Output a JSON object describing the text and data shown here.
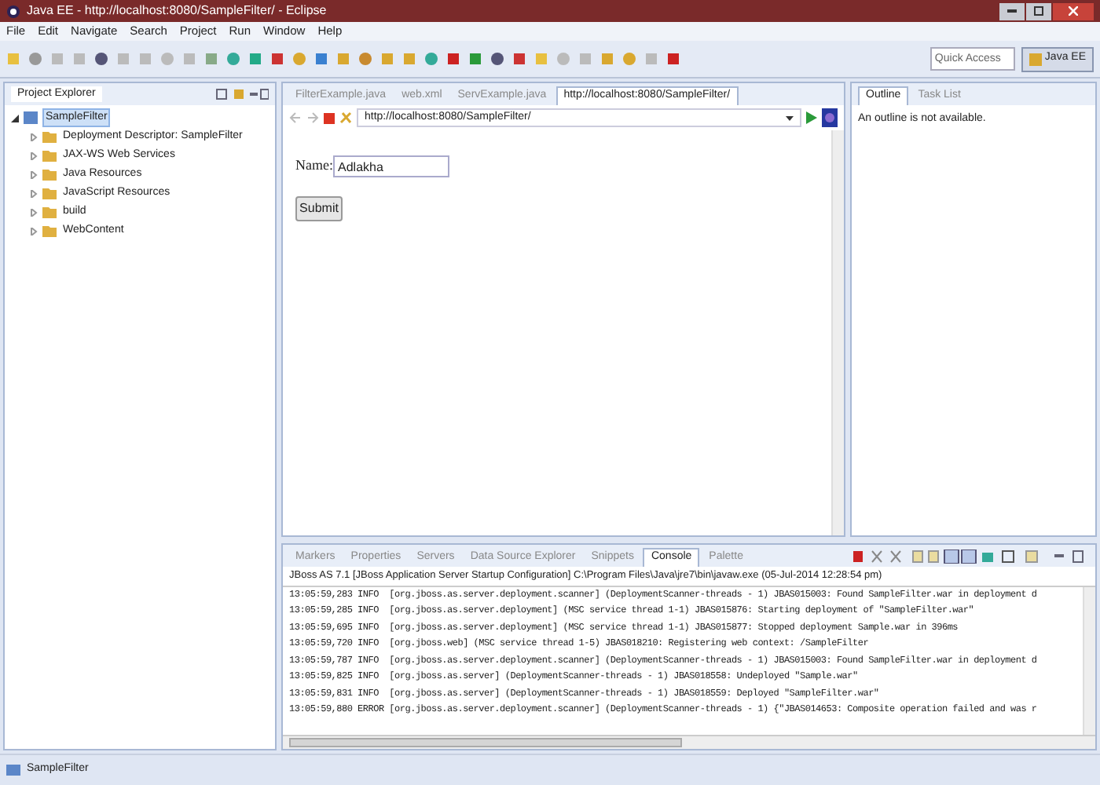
{
  "window": {
    "title": "Java EE - http://localhost:8080/SampleFilter/ - Eclipse"
  },
  "menu": [
    "File",
    "Edit",
    "Navigate",
    "Search",
    "Project",
    "Run",
    "Window",
    "Help"
  ],
  "toolbar": {
    "quick_access": {
      "placeholder": "Quick Access"
    },
    "perspective": "Java EE"
  },
  "project_explorer": {
    "title": "Project Explorer",
    "tree": [
      {
        "label": "SampleFilter",
        "expanded": true,
        "selected": true,
        "children": [
          {
            "label": "Deployment Descriptor: SampleFilter",
            "expanded": false,
            "selected": false
          },
          {
            "label": "JAX-WS Web Services",
            "expanded": false,
            "selected": false
          },
          {
            "label": "Java Resources",
            "expanded": false,
            "selected": false
          },
          {
            "label": "JavaScript Resources",
            "expanded": false,
            "selected": false
          },
          {
            "label": "build",
            "expanded": false,
            "selected": false
          },
          {
            "label": "WebContent",
            "expanded": false,
            "selected": false
          }
        ]
      }
    ]
  },
  "editor": {
    "tabs": [
      {
        "label": "FilterExample.java",
        "selected": false
      },
      {
        "label": "web.xml",
        "selected": false
      },
      {
        "label": "ServExample.java",
        "selected": false
      },
      {
        "label": "http://localhost:8080/SampleFilter/",
        "selected": true
      }
    ],
    "url": "http://localhost:8080/SampleFilter/",
    "name_label": "Name:",
    "name_value": "Adlakha",
    "submit": "Submit"
  },
  "outline": {
    "tabs": [
      {
        "label": "Outline",
        "selected": true
      },
      {
        "label": "Task List",
        "selected": false
      }
    ],
    "message": "An outline is not available."
  },
  "console": {
    "tabs": [
      {
        "label": "Markers",
        "selected": false
      },
      {
        "label": "Properties",
        "selected": false
      },
      {
        "label": "Servers",
        "selected": false
      },
      {
        "label": "Data Source Explorer",
        "selected": false
      },
      {
        "label": "Snippets",
        "selected": false
      },
      {
        "label": "Console",
        "selected": true
      },
      {
        "label": "Palette",
        "selected": false
      }
    ],
    "header": "JBoss AS 7.1 [JBoss Application Server Startup Configuration] C:\\Program Files\\Java\\jre7\\bin\\javaw.exe (05-Jul-2014 12:28:54 pm)",
    "lines": [
      "13:05:59,283 INFO  [org.jboss.as.server.deployment.scanner] (DeploymentScanner-threads - 1) JBAS015003: Found SampleFilter.war in deployment d",
      "13:05:59,285 INFO  [org.jboss.as.server.deployment] (MSC service thread 1-1) JBAS015876: Starting deployment of \"SampleFilter.war\"",
      "13:05:59,695 INFO  [org.jboss.as.server.deployment] (MSC service thread 1-1) JBAS015877: Stopped deployment Sample.war in 396ms",
      "13:05:59,720 INFO  [org.jboss.web] (MSC service thread 1-5) JBAS018210: Registering web context: /SampleFilter",
      "13:05:59,787 INFO  [org.jboss.as.server.deployment.scanner] (DeploymentScanner-threads - 1) JBAS015003: Found SampleFilter.war in deployment d",
      "13:05:59,825 INFO  [org.jboss.as.server] (DeploymentScanner-threads - 1) JBAS018558: Undeployed \"Sample.war\"",
      "13:05:59,831 INFO  [org.jboss.as.server] (DeploymentScanner-threads - 1) JBAS018559: Deployed \"SampleFilter.war\"",
      "13:05:59,880 ERROR [org.jboss.as.server.deployment.scanner] (DeploymentScanner-threads - 1) {\"JBAS014653: Composite operation failed and was r"
    ]
  },
  "status_bar": {
    "text": "SampleFilter"
  }
}
